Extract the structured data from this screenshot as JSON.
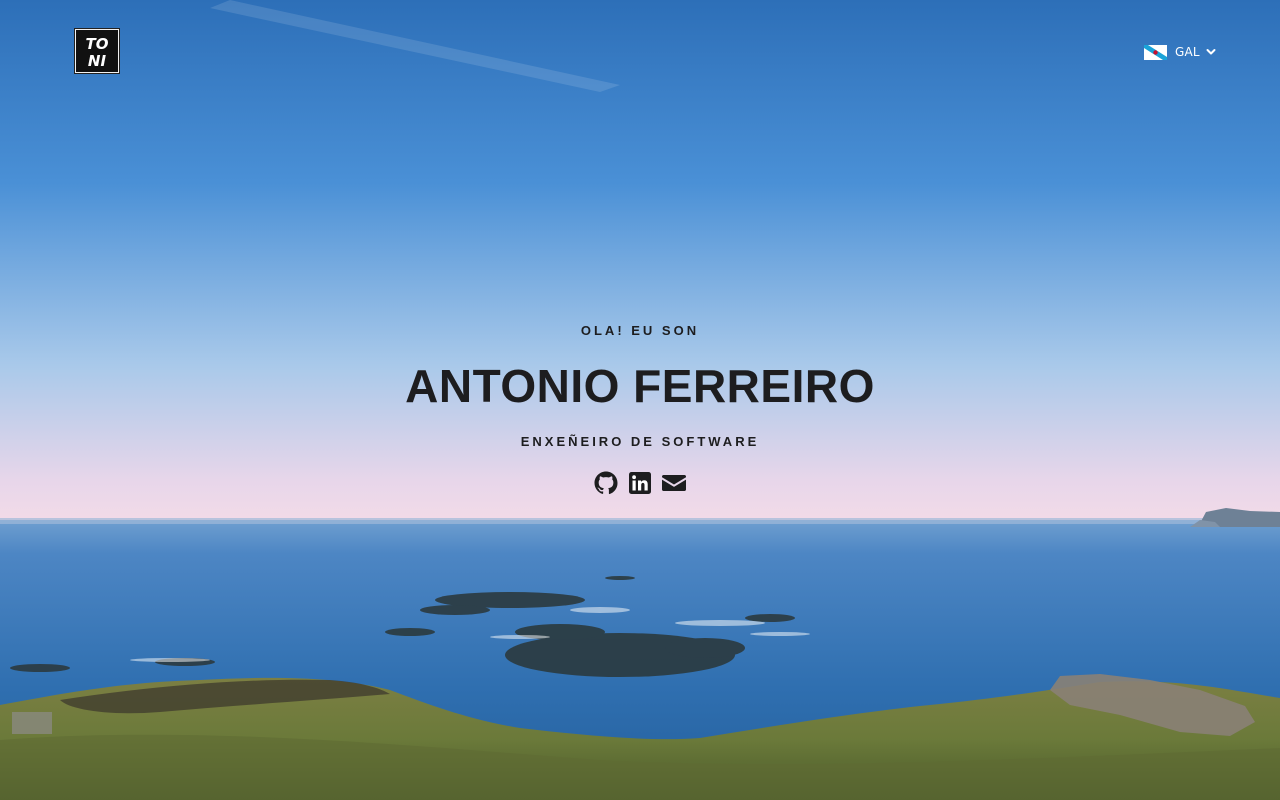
{
  "header": {
    "logo": {
      "text_line1": "TO",
      "text_line2": "NI"
    },
    "language": {
      "selected": "GAL",
      "flag": "galicia-flag-icon"
    }
  },
  "hero": {
    "intro": "OLA! EU SON",
    "name": "ANTONIO FERREIRO",
    "role": "ENXEÑEIRO DE SOFTWARE",
    "socials": [
      {
        "icon": "github-icon"
      },
      {
        "icon": "linkedin-icon"
      },
      {
        "icon": "envelope-icon"
      }
    ]
  },
  "colors": {
    "text": "#1d1d1f",
    "sky_top": "#2d6fb8",
    "sky_horizon": "#f2dbe8",
    "sea": "#2f6fb0",
    "grass": "#6b7a3a"
  }
}
